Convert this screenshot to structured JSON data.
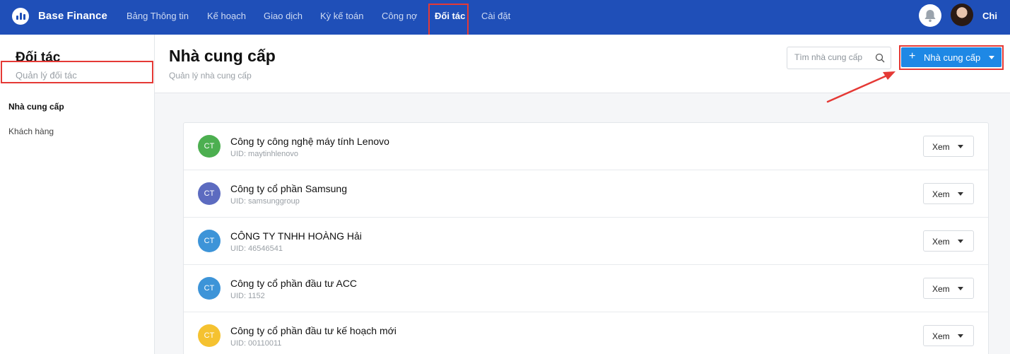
{
  "app": {
    "brand": "Base Finance"
  },
  "nav": {
    "items": [
      {
        "label": "Bảng Thông tin"
      },
      {
        "label": "Kế hoạch"
      },
      {
        "label": "Giao dịch"
      },
      {
        "label": "Kỳ kế toán"
      },
      {
        "label": "Công nợ"
      },
      {
        "label": "Đối tác",
        "active": true
      },
      {
        "label": "Cài đặt"
      }
    ]
  },
  "user": {
    "name": "Chi",
    "avatar_icon": "user-avatar",
    "notification_icon": "bell-icon"
  },
  "sidebar": {
    "title": "Đối tác",
    "subtitle": "Quản lý đối tác",
    "items": [
      {
        "label": "Nhà cung cấp",
        "active": true
      },
      {
        "label": "Khách hàng"
      }
    ]
  },
  "header": {
    "title": "Nhà cung cấp",
    "subtitle": "Quản lý nhà cung cấp",
    "search_placeholder": "Tìm nhà cung cấp",
    "add_button": "Nhà cung cấp",
    "add_icon": "+"
  },
  "suppliers": [
    {
      "initials": "CT",
      "name": "Công ty công nghệ máy tính Lenovo",
      "uid": "UID: maytinhlenovo",
      "action": "Xem",
      "color": "#4caf50"
    },
    {
      "initials": "CT",
      "name": "Công ty cổ phần Samsung",
      "uid": "UID: samsunggroup",
      "action": "Xem",
      "color": "#5c6bc0"
    },
    {
      "initials": "CT",
      "name": "CÔNG TY TNHH HOÀNG Hải",
      "uid": "UID: 46546541",
      "action": "Xem",
      "color": "#3d94d8"
    },
    {
      "initials": "CT",
      "name": "Công ty cổ phần đầu tư ACC",
      "uid": "UID: 1152",
      "action": "Xem",
      "color": "#3d94d8"
    },
    {
      "initials": "CT",
      "name": "Công ty cổ phần đầu tư kế hoạch mới",
      "uid": "UID: 00110011",
      "action": "Xem",
      "color": "#f5c230"
    }
  ],
  "colors": {
    "topbar": "#1f4fb8",
    "accent": "#1e88e5",
    "highlight": "#e53935"
  }
}
